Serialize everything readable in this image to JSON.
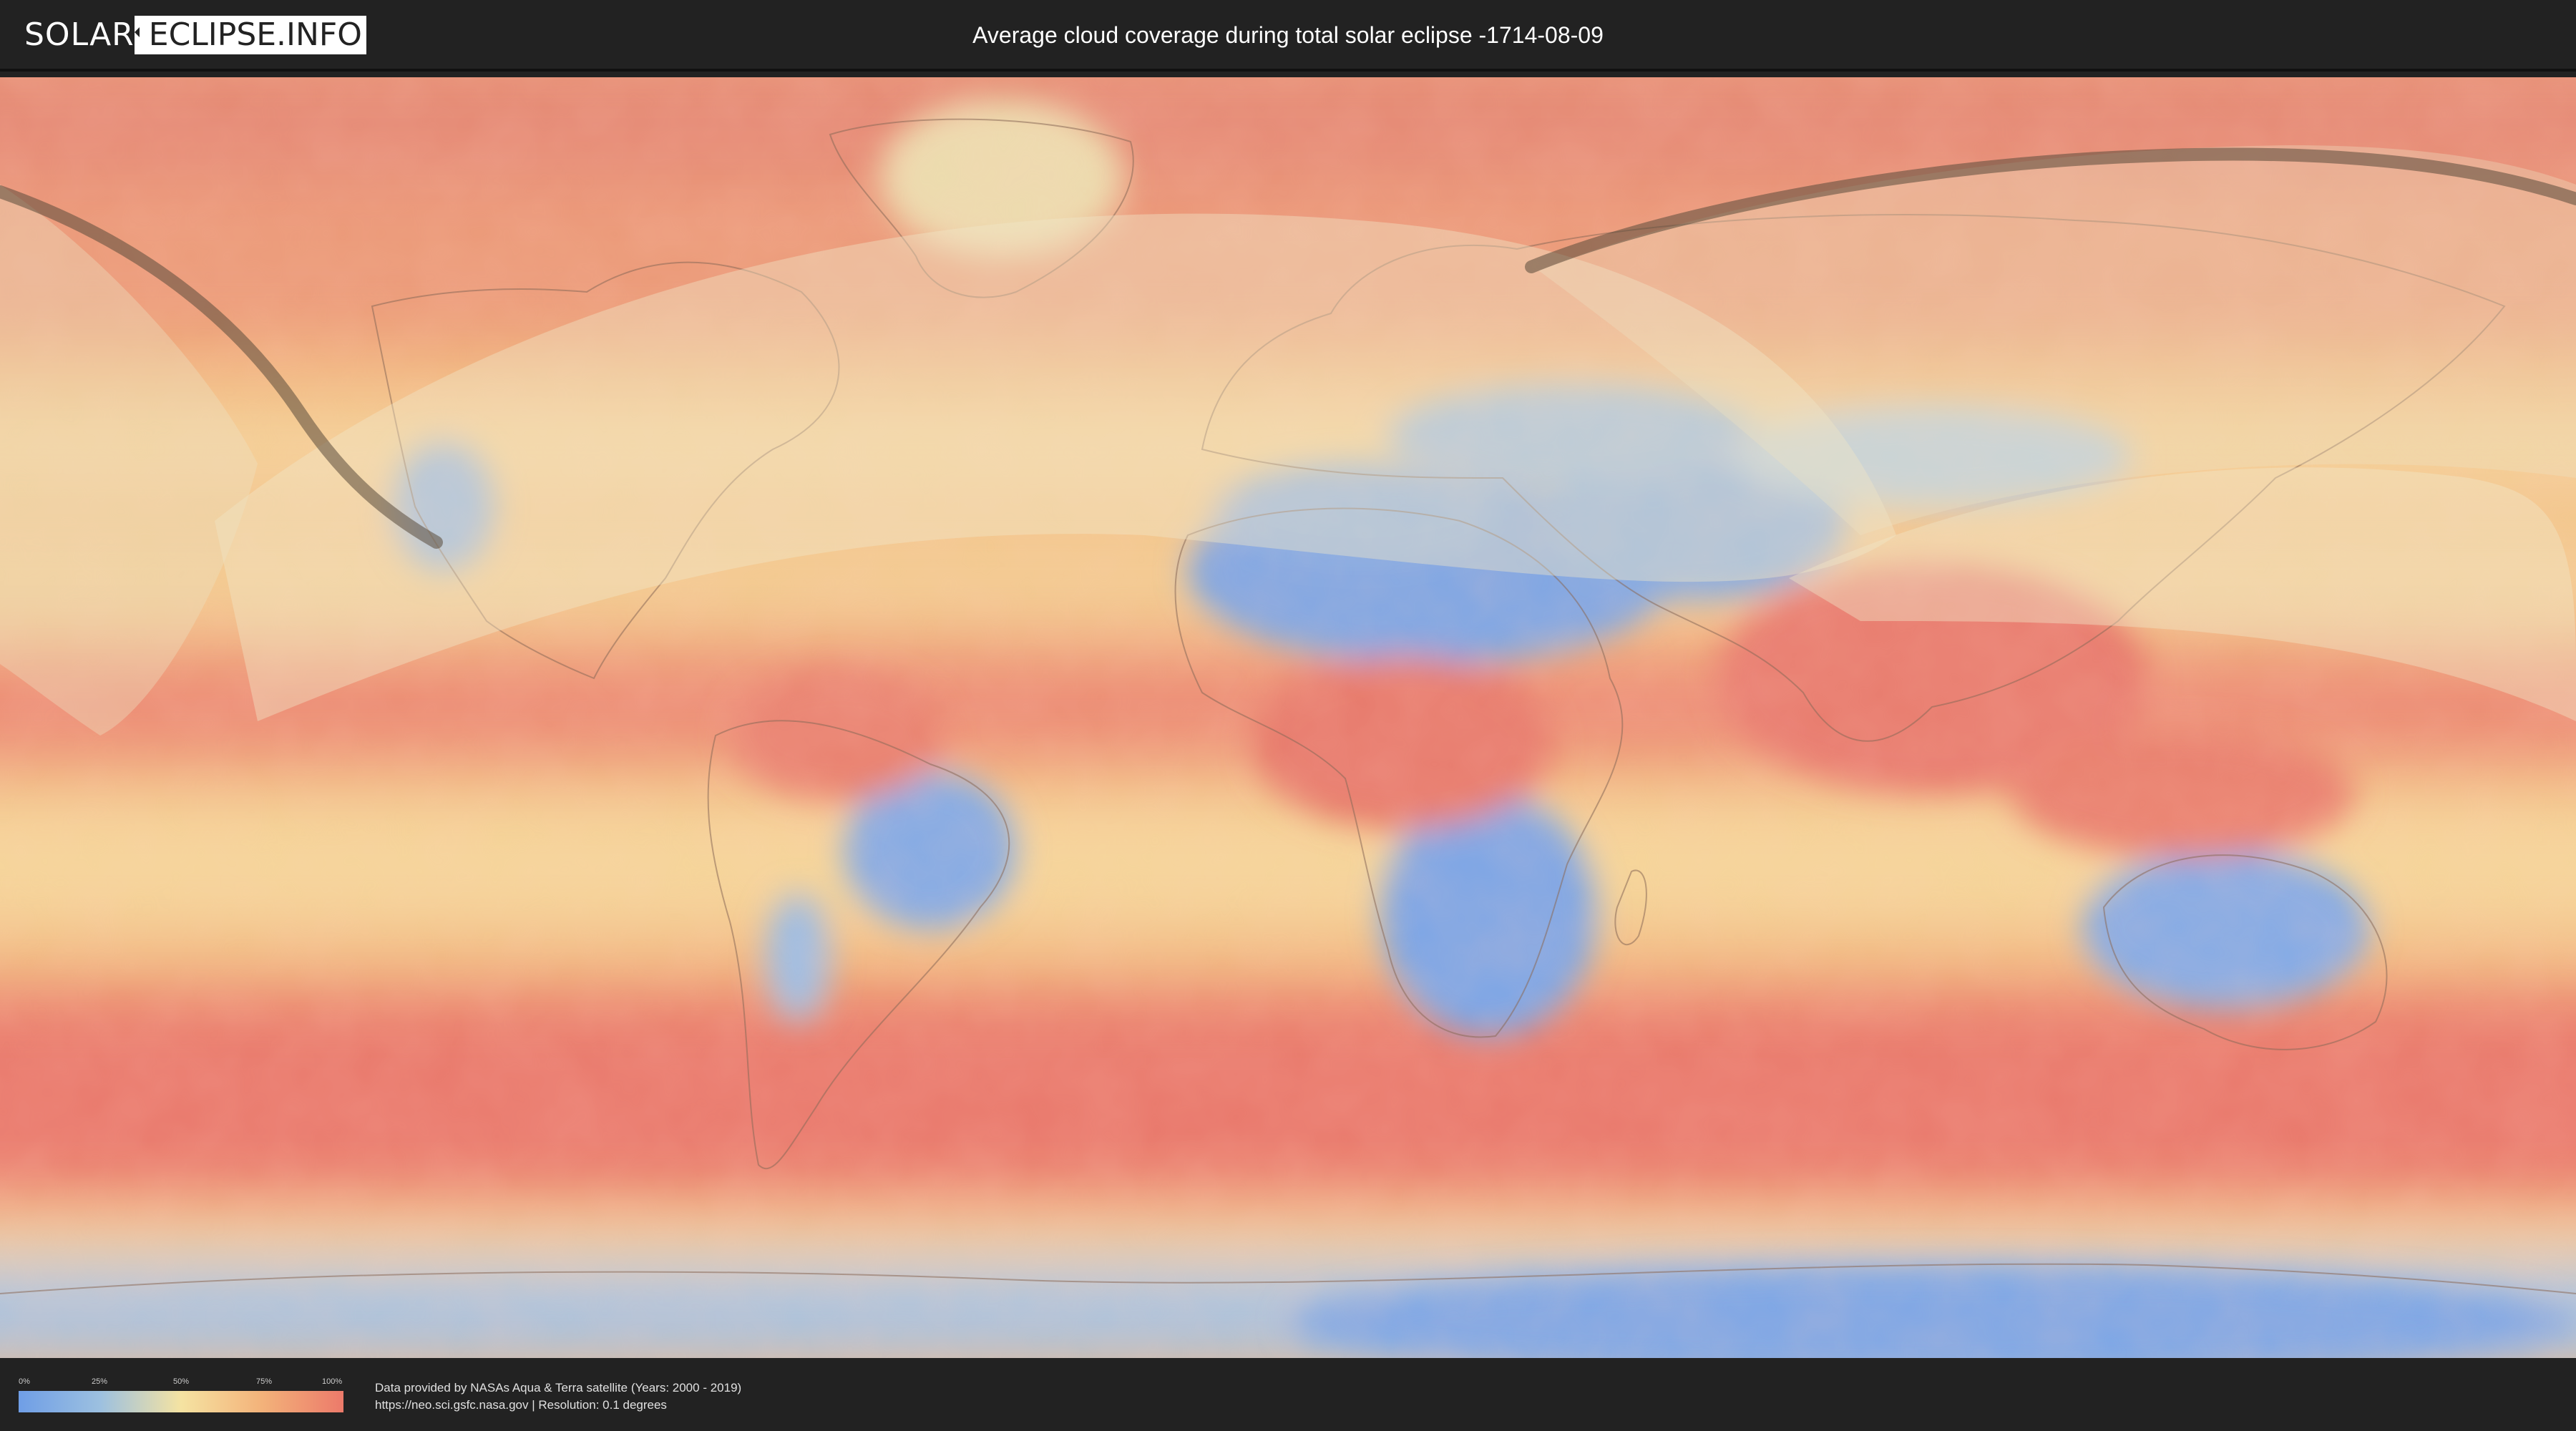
{
  "header": {
    "logo": {
      "prefix": "SOLAR",
      "suffix": "ECLIPSE.INFO"
    },
    "title": "Average cloud coverage during total solar eclipse -1714-08-09"
  },
  "map": {
    "description_colors": {
      "clear": "#7aa6e8",
      "low": "#a8c8e6",
      "medium": "#f3dc9c",
      "high": "#f2b07c",
      "overcast": "#e97b70"
    },
    "overlay_color": "#f0e6c8",
    "eclipse_path_color": "#5a4a3a"
  },
  "footer": {
    "legend": {
      "ticks": [
        "0%",
        "25%",
        "50%",
        "75%",
        "100%"
      ],
      "gradient": [
        "#6f9ee6",
        "#9cc0e0",
        "#f5e3a2",
        "#f3b27a",
        "#ec7a6a"
      ]
    },
    "credit_line1": "Data provided by NASAs Aqua & Terra satellite (Years: 2000 - 2019)",
    "credit_line2": "https://neo.sci.gsfc.nasa.gov | Resolution: 0.1 degrees"
  }
}
